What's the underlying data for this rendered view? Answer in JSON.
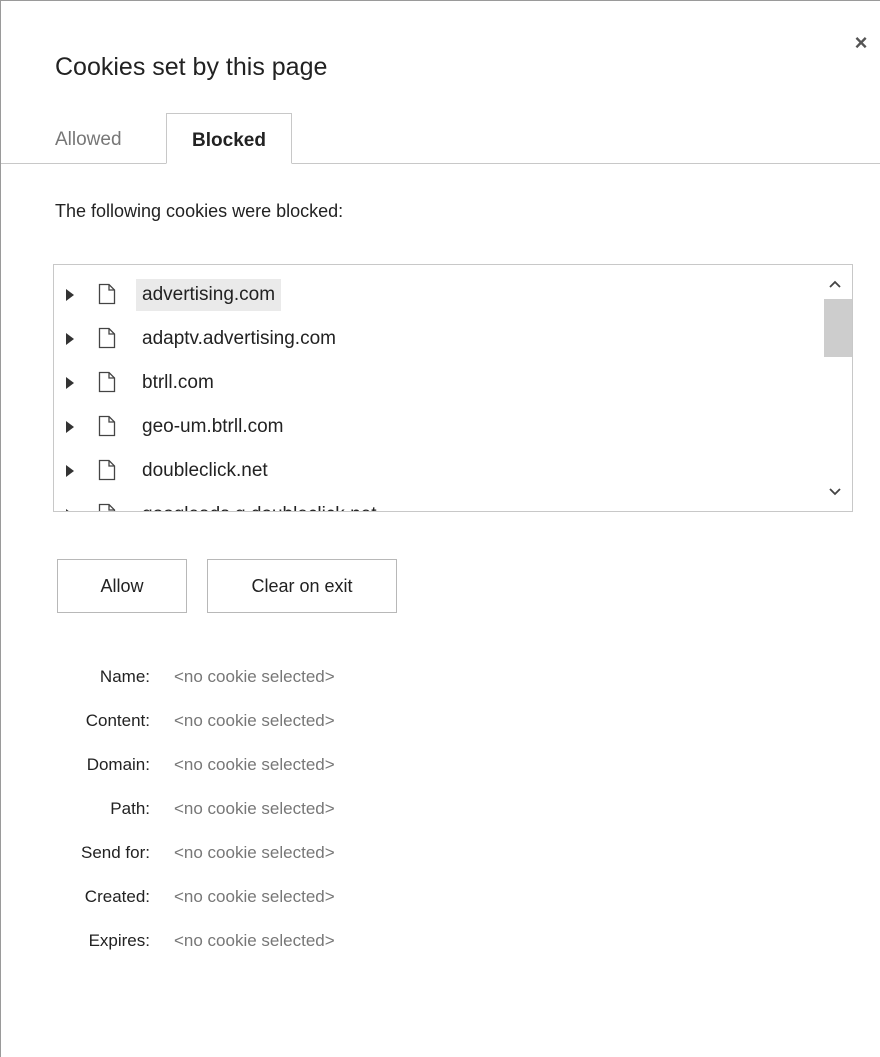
{
  "dialog": {
    "title": "Cookies set by this page",
    "close_symbol": "×"
  },
  "tabs": [
    {
      "label": "Allowed",
      "active": false
    },
    {
      "label": "Blocked",
      "active": true
    }
  ],
  "description": "The following cookies were blocked:",
  "cookies": [
    {
      "domain": "advertising.com",
      "selected": true
    },
    {
      "domain": "adaptv.advertising.com",
      "selected": false
    },
    {
      "domain": "btrll.com",
      "selected": false
    },
    {
      "domain": "geo-um.btrll.com",
      "selected": false
    },
    {
      "domain": "doubleclick.net",
      "selected": false
    },
    {
      "domain": "googleads.g.doubleclick.net",
      "selected": false
    }
  ],
  "buttons": {
    "allow": "Allow",
    "clear_on_exit": "Clear on exit"
  },
  "details": [
    {
      "key": "Name:",
      "value": "<no cookie selected>"
    },
    {
      "key": "Content:",
      "value": "<no cookie selected>"
    },
    {
      "key": "Domain:",
      "value": "<no cookie selected>"
    },
    {
      "key": "Path:",
      "value": "<no cookie selected>"
    },
    {
      "key": "Send for:",
      "value": "<no cookie selected>"
    },
    {
      "key": "Created:",
      "value": "<no cookie selected>"
    },
    {
      "key": "Expires:",
      "value": "<no cookie selected>"
    }
  ],
  "icons": {
    "expand": "triangle-right-icon",
    "file": "file-icon",
    "close": "close-icon",
    "scroll_up": "chevron-up-icon",
    "scroll_down": "chevron-down-icon"
  }
}
